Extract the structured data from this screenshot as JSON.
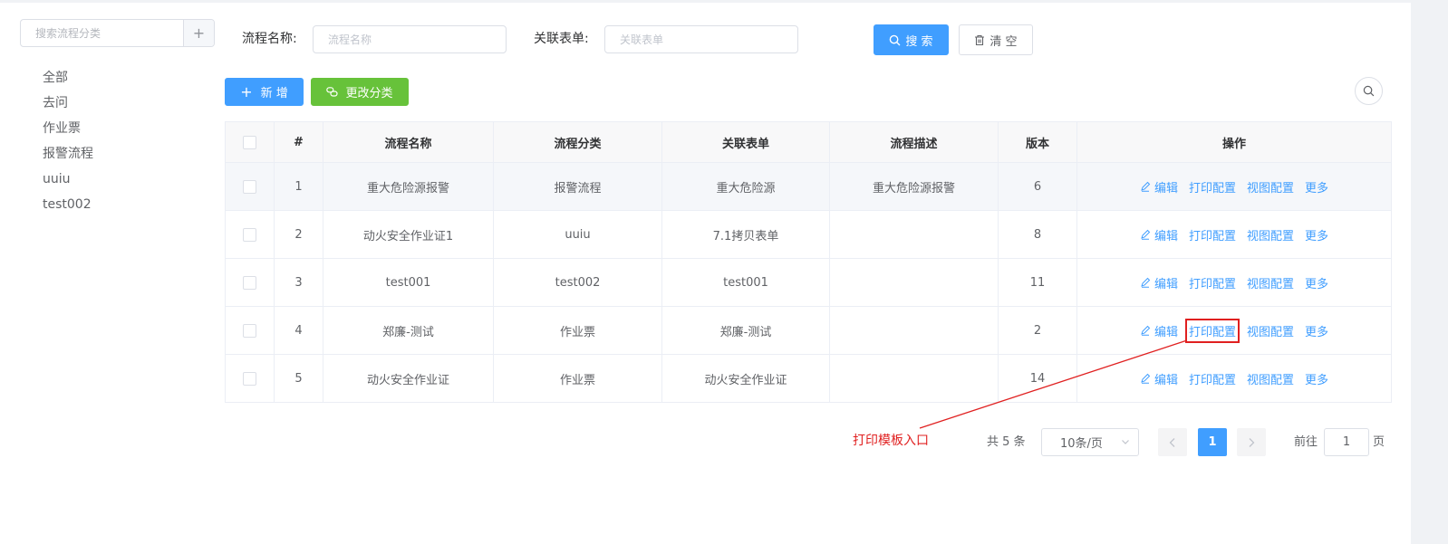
{
  "category_panel": {
    "search_placeholder": "搜索流程分类",
    "add_icon": "plus-icon",
    "items": [
      "全部",
      "去问",
      "作业票",
      "报警流程",
      "uuiu",
      "test002"
    ]
  },
  "search_form": {
    "name_label": "流程名称:",
    "name_placeholder": "流程名称",
    "form_label": "关联表单:",
    "form_placeholder": "关联表单",
    "search_button": "搜 索",
    "clear_button": "清 空"
  },
  "toolbar": {
    "add_button": "新 增",
    "change_category_button": "更改分类",
    "search_toggle_icon": "search-icon"
  },
  "table": {
    "headers": [
      "#",
      "流程名称",
      "流程分类",
      "关联表单",
      "流程描述",
      "版本",
      "操作"
    ],
    "rows": [
      {
        "index": "1",
        "name": "重大危险源报警",
        "category": "报警流程",
        "form": "重大危险源",
        "description": "重大危险源报警",
        "version": "6"
      },
      {
        "index": "2",
        "name": "动火安全作业证1",
        "category": "uuiu",
        "form": "7.1拷贝表单",
        "description": "",
        "version": "8"
      },
      {
        "index": "3",
        "name": "test001",
        "category": "test002",
        "form": "test001",
        "description": "",
        "version": "11"
      },
      {
        "index": "4",
        "name": "郑廉-测试",
        "category": "作业票",
        "form": "郑廉-测试",
        "description": "",
        "version": "2"
      },
      {
        "index": "5",
        "name": "动火安全作业证",
        "category": "作业票",
        "form": "动火安全作业证",
        "description": "",
        "version": "14"
      }
    ],
    "actions": {
      "edit": "编辑",
      "print_config": "打印配置",
      "view_config": "视图配置",
      "more": "更多"
    }
  },
  "pagination": {
    "total": "共 5 条",
    "page_size": "10条/页",
    "current_page": "1",
    "goto_prefix": "前往",
    "goto_value": "1",
    "goto_suffix": "页"
  },
  "annotation": {
    "text": "打印模板入口",
    "color": "#e02020"
  },
  "colors": {
    "primary": "#409eff",
    "success": "#67c23a",
    "annotation": "#e02020"
  }
}
